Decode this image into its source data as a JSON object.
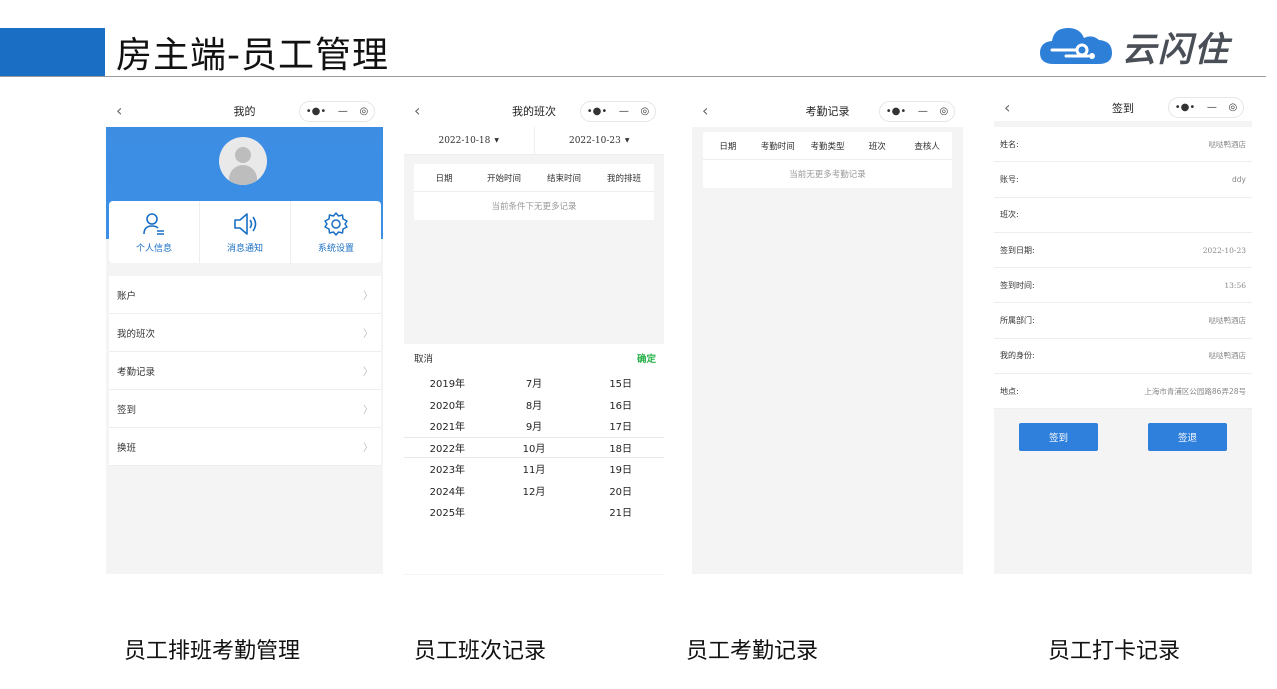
{
  "header": {
    "title": "房主端-员工管理",
    "logo_text": "云闪住"
  },
  "capsule": {
    "dots": "•●•",
    "minus": "—",
    "target": "◎"
  },
  "phone1": {
    "nav_title": "我的",
    "quick_actions": [
      {
        "label": "个人信息",
        "icon": "user-list-icon"
      },
      {
        "label": "消息通知",
        "icon": "speaker-icon"
      },
      {
        "label": "系统设置",
        "icon": "gear-icon"
      }
    ],
    "menu": [
      "账户",
      "我的班次",
      "考勤记录",
      "签到",
      "换班"
    ],
    "chevron": "〉"
  },
  "phone2": {
    "nav_title": "我的班次",
    "date_start": "2022-10-18",
    "date_end": "2022-10-23",
    "columns": [
      "日期",
      "开始时间",
      "结束时间",
      "我的排班"
    ],
    "empty_text": "当前条件下无更多记录",
    "picker": {
      "cancel": "取消",
      "confirm": "确定",
      "years": [
        "2019年",
        "2020年",
        "2021年",
        "2022年",
        "2023年",
        "2024年",
        "2025年"
      ],
      "months": [
        "7月",
        "8月",
        "9月",
        "10月",
        "11月",
        "12月",
        ""
      ],
      "days": [
        "15日",
        "16日",
        "17日",
        "18日",
        "19日",
        "20日",
        "21日"
      ]
    }
  },
  "phone3": {
    "nav_title": "考勤记录",
    "columns": [
      "日期",
      "考勤时间",
      "考勤类型",
      "班次",
      "查核人"
    ],
    "empty_text": "当前无更多考勤记录"
  },
  "phone4": {
    "nav_title": "签到",
    "fields": [
      {
        "label": "姓名:",
        "value": "哒哒鸭酒店"
      },
      {
        "label": "账号:",
        "value": "ddy"
      },
      {
        "label": "班次:",
        "value": ""
      },
      {
        "label": "签到日期:",
        "value": "2022-10-23"
      },
      {
        "label": "签到时间:",
        "value": "13:56"
      },
      {
        "label": "所属部门:",
        "value": "哒哒鸭酒店"
      },
      {
        "label": "我的身份:",
        "value": "哒哒鸭酒店"
      },
      {
        "label": "地点:",
        "value": "上海市青浦区公园路86弄28号"
      }
    ],
    "sign_in": "签到",
    "sign_out": "签退"
  },
  "captions": [
    "员工排班考勤管理",
    "员工班次记录",
    "员工考勤记录",
    "员工打卡记录"
  ],
  "colors": {
    "accent": "#1a6fc4",
    "header_blue": "#3b8fe6",
    "confirm_green": "#2bb34b"
  }
}
